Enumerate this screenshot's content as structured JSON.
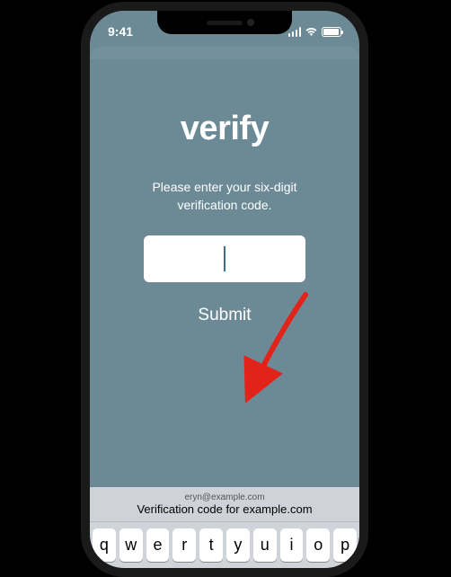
{
  "status": {
    "time": "9:41"
  },
  "verify": {
    "title": "verify",
    "instruction_line1": "Please enter your six-digit",
    "instruction_line2": "verification code.",
    "submit_label": "Submit"
  },
  "autofill": {
    "email": "eryn@example.com",
    "description": "Verification code for example.com"
  },
  "keyboard": {
    "row1": [
      "q",
      "w",
      "e",
      "r",
      "t",
      "y",
      "u",
      "i",
      "o",
      "p"
    ]
  }
}
